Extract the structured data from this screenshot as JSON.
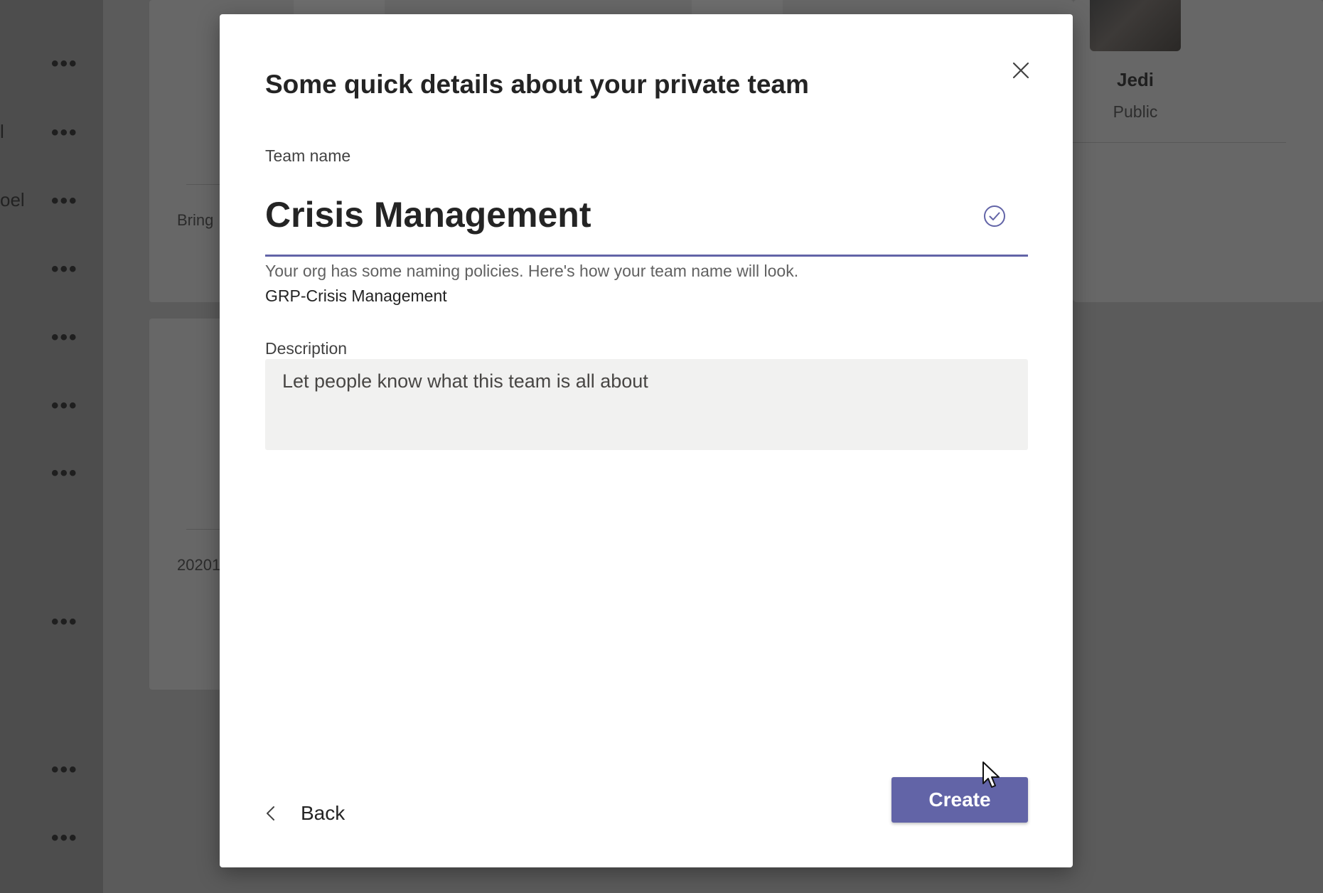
{
  "background": {
    "edge_texts": [
      "l",
      "oel"
    ],
    "card_texts": [
      "Bring",
      "20201"
    ],
    "team": {
      "name": "Jedi",
      "type": "Public"
    }
  },
  "dialog": {
    "title": "Some quick details about your private team",
    "team_name_label": "Team name",
    "team_name_value": "Crisis Management",
    "policy_note": "Your org has some naming policies. Here's how your team name will look.",
    "policy_preview": "GRP-Crisis Management",
    "description_label": "Description",
    "description_placeholder": "Let people know what this team is all about",
    "description_value": "",
    "back_label": "Back",
    "create_label": "Create"
  },
  "icons": {
    "close": "close-icon",
    "check": "check-circle-icon",
    "back": "chevron-left-icon",
    "more": "more-options-icon",
    "cursor": "mouse-cursor-icon"
  },
  "colors": {
    "accent": "#6264a7",
    "overlay": "#5a5a5a",
    "dialog_bg": "#ffffff",
    "input_bg": "#f1f1f0",
    "text": "#242424"
  }
}
